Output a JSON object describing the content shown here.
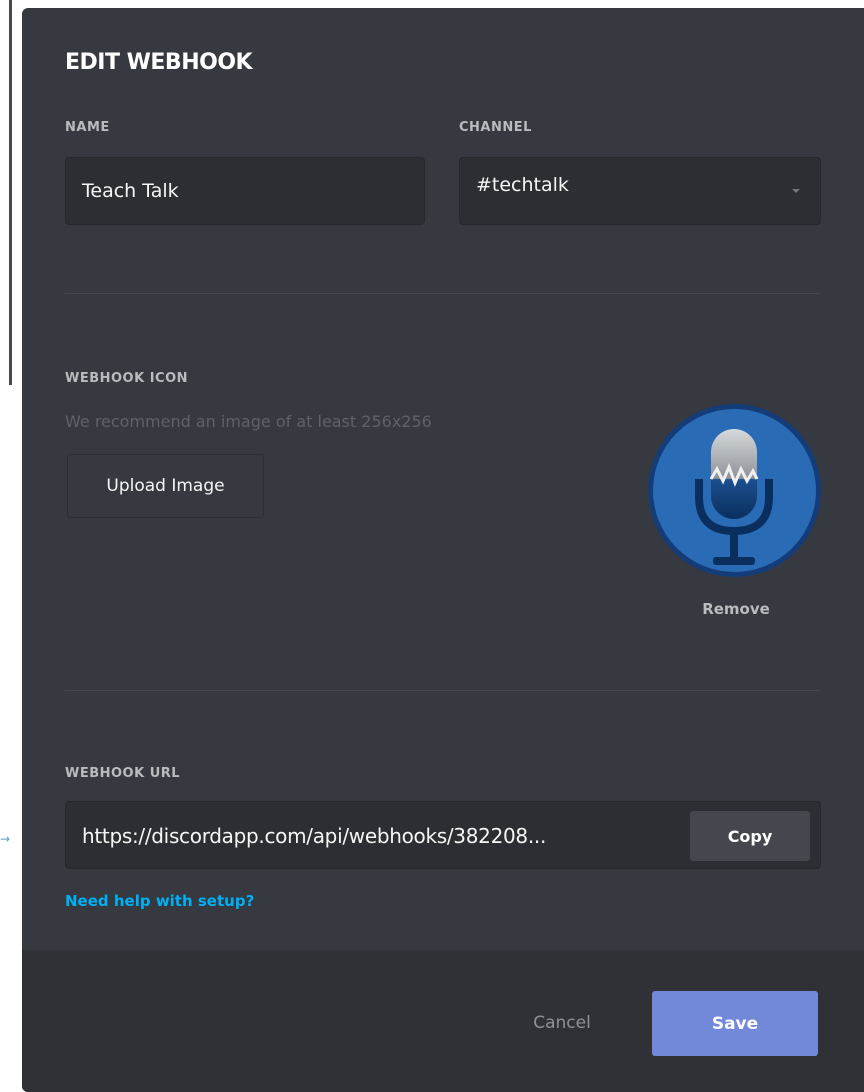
{
  "modal": {
    "title": "EDIT WEBHOOK"
  },
  "form": {
    "name_label": "NAME",
    "name_value": "Teach Talk",
    "channel_label": "CHANNEL",
    "channel_value": "#techtalk"
  },
  "icon_section": {
    "label": "WEBHOOK ICON",
    "hint": "We recommend an image of at least 256x256",
    "upload_label": "Upload Image",
    "remove_label": "Remove",
    "icon": "microphone-icon"
  },
  "url_section": {
    "label": "WEBHOOK URL",
    "url": "https://discordapp.com/api/webhooks/382208...",
    "copy_label": "Copy",
    "help_link": "Need help with setup?"
  },
  "footer": {
    "cancel_label": "Cancel",
    "save_label": "Save"
  },
  "colors": {
    "modal_bg": "#36393f",
    "footer_bg": "#2f3136",
    "input_bg": "#2c2e33",
    "accent": "#7289da",
    "link": "#00b0f4"
  }
}
